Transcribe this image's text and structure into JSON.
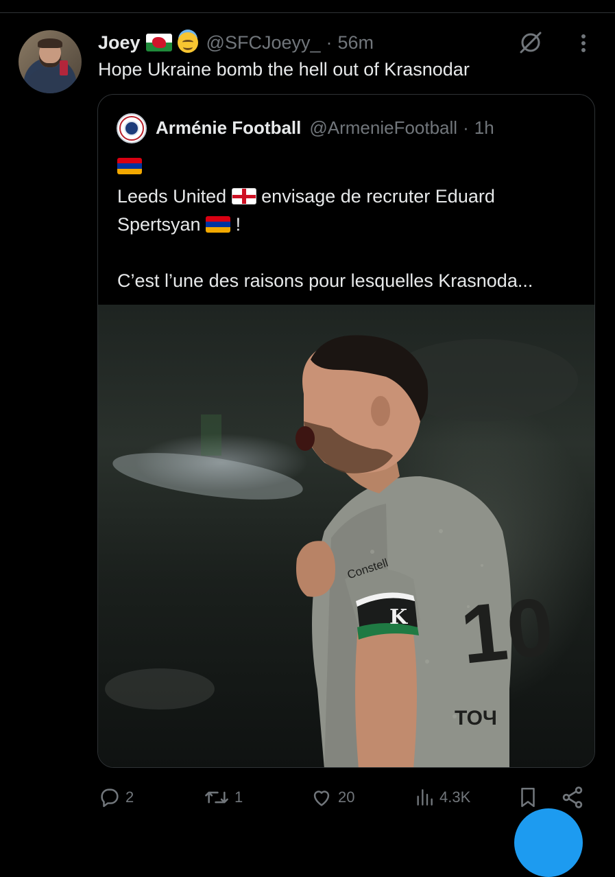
{
  "tweet": {
    "author_name": "Joey",
    "handle": "@SFCJoeyy_",
    "separator": "·",
    "time": "56m",
    "text": "Hope Ukraine bomb the hell out of Krasnodar"
  },
  "quote": {
    "author_name": "Arménie Football",
    "handle": "@ArmenieFootball",
    "separator": "·",
    "time": "1h",
    "line1_a": "Leeds United",
    "line1_b": "envisage de recruter Eduard",
    "line2_a": "Spertsyan",
    "line2_b": "!",
    "para2": "C’est l’une des raisons pour lesquelles Krasnoda...",
    "jersey_sponsor": "Constell",
    "jersey_name": "ТОЧ",
    "armband_letter": "K"
  },
  "actions": {
    "replies": "2",
    "reposts": "1",
    "likes": "20",
    "views": "4.3K"
  },
  "icons": [
    "grok-icon",
    "more-icon",
    "reply-icon",
    "repost-icon",
    "like-icon",
    "views-icon",
    "bookmark-icon",
    "share-icon"
  ],
  "colors": {
    "background": "#000000",
    "text": "#e7e9ea",
    "muted": "#71767b",
    "accent": "#1d9bf0",
    "border": "#2f3336"
  }
}
